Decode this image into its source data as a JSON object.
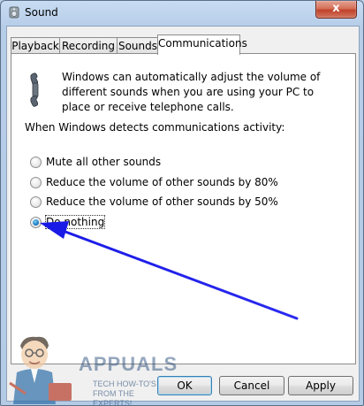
{
  "window": {
    "title": "Sound",
    "close_glyph": "x"
  },
  "tabs": [
    {
      "label": "Playback",
      "selected": false
    },
    {
      "label": "Recording",
      "selected": false
    },
    {
      "label": "Sounds",
      "selected": false
    },
    {
      "label": "Communications",
      "selected": true
    }
  ],
  "panel": {
    "icon": "telephone-icon",
    "info_text": "Windows can automatically adjust the volume of different sounds when you are using your PC to place or receive telephone calls.",
    "detect_label": "When Windows detects communications activity:",
    "options": [
      {
        "label": "Mute all other sounds",
        "checked": false
      },
      {
        "label": "Reduce the volume of other sounds by 80%",
        "checked": false
      },
      {
        "label": "Reduce the volume of other sounds by 50%",
        "checked": false
      },
      {
        "label": "Do nothing",
        "checked": true
      }
    ]
  },
  "buttons": {
    "ok": "OK",
    "cancel": "Cancel",
    "apply": "Apply"
  },
  "annotation": {
    "arrow_color": "#1a1ae6"
  },
  "watermark": {
    "brand": "APPUALS",
    "tagline": "TECH HOW-TO'S FROM THE EXPERTS!"
  }
}
